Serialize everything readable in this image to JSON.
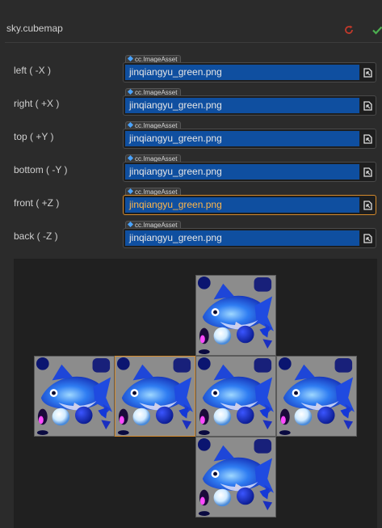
{
  "header": {
    "title": "sky.cubemap"
  },
  "colors": {
    "field_bg": "#0f4fa0",
    "focus": "#d48a2c",
    "revert": "#c0392b",
    "apply": "#4caf50"
  },
  "faces": [
    {
      "id": "left",
      "label": "left ( -X )",
      "asset_type": "cc.ImageAsset",
      "value": "jinqiangyu_green.png"
    },
    {
      "id": "right",
      "label": "right ( +X )",
      "asset_type": "cc.ImageAsset",
      "value": "jinqiangyu_green.png"
    },
    {
      "id": "top",
      "label": "top ( +Y )",
      "asset_type": "cc.ImageAsset",
      "value": "jinqiangyu_green.png"
    },
    {
      "id": "bottom",
      "label": "bottom ( -Y )",
      "asset_type": "cc.ImageAsset",
      "value": "jinqiangyu_green.png"
    },
    {
      "id": "front",
      "label": "front ( +Z )",
      "asset_type": "cc.ImageAsset",
      "value": "jinqiangyu_green.png",
      "focused": true
    },
    {
      "id": "back",
      "label": "back ( -Z )",
      "asset_type": "cc.ImageAsset",
      "value": "jinqiangyu_green.png"
    }
  ]
}
